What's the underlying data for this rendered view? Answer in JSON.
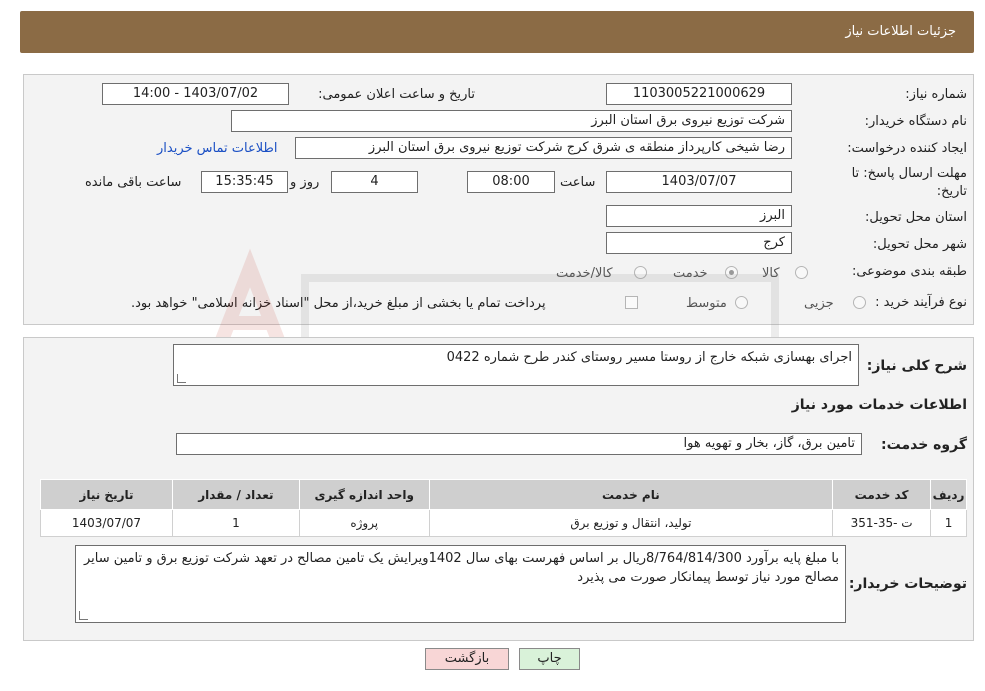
{
  "header": {
    "title": "جزئیات اطلاعات نیاز"
  },
  "need_number": {
    "label": "شماره نیاز:",
    "value": "1103005221000629"
  },
  "announce": {
    "label": "تاریخ و ساعت اعلان عمومی:",
    "value": "1403/07/02 - 14:00"
  },
  "buyer_org": {
    "label": "نام دستگاه خریدار:",
    "value": "شرکت توزیع نیروی برق استان البرز"
  },
  "requester": {
    "label": "ایجاد کننده درخواست:",
    "value": "رضا شیخی کارپرداز منطقه ی شرق کرج شرکت توزیع نیروی برق استان البرز",
    "contact_link": "اطلاعات تماس خریدار"
  },
  "deadline": {
    "label_line1": "مهلت ارسال پاسخ: تا",
    "label_line2": "تاریخ:",
    "date": "1403/07/07",
    "time_label": "ساعت",
    "time": "08:00",
    "days": "4",
    "days_label": "روز و",
    "remaining": "15:35:45",
    "remaining_label": "ساعت باقی مانده"
  },
  "province": {
    "label": "استان محل تحویل:",
    "value": "البرز"
  },
  "city": {
    "label": "شهر محل تحویل:",
    "value": "کرج"
  },
  "category": {
    "label": "طبقه بندی موضوعی:",
    "options": [
      "کالا",
      "خدمت",
      "کالا/خدمت"
    ],
    "selected": "خدمت"
  },
  "process": {
    "label": "نوع فرآیند خرید :",
    "options": [
      "جزیی",
      "متوسط"
    ],
    "note": "پرداخت تمام یا بخشی از مبلغ خرید،از محل \"اسناد خزانه اسلامی\" خواهد بود."
  },
  "description": {
    "label": "شرح کلی نیاز:",
    "value": "اجرای بهسازی شبکه خارج از روستا مسیر روستای کندر طرح شماره 0422"
  },
  "services_title": "اطلاعات خدمات مورد نیاز",
  "service_group": {
    "label": "گروه خدمت:",
    "value": "تامین برق، گاز، بخار و تهویه هوا"
  },
  "table": {
    "headers": [
      "ردیف",
      "کد خدمت",
      "نام خدمت",
      "واحد اندازه گیری",
      "تعداد / مقدار",
      "تاریخ نیاز"
    ],
    "rows": [
      [
        "1",
        "ت -35-351",
        "تولید، انتقال و توزیع برق",
        "پروژه",
        "1",
        "1403/07/07"
      ]
    ]
  },
  "buyer_notes": {
    "label": "توضیحات خریدار:",
    "value": "با مبلغ  پایه برآورد    8/764/814/300ریال بر اساس فهرست بهای سال  1402ویرایش یک  تامین  مصالح در تعهد  شرکت توزیع برق و تامین سایر مصالح مورد نیاز توسط پیمانکار صورت می پذیرد"
  },
  "buttons": {
    "print": "چاپ",
    "back": "بازگشت"
  },
  "colors": {
    "header_bg": "#8b6b45",
    "link": "#1a4fc4",
    "back_btn": "#f8d6d6",
    "print_btn": "#d9f2d9"
  }
}
